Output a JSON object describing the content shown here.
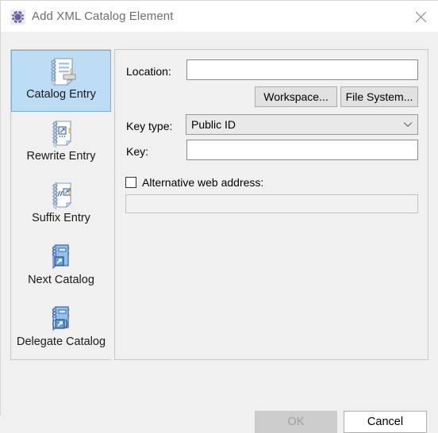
{
  "window": {
    "title": "Add XML Catalog Element",
    "icon": "xml-catalog-icon",
    "close_icon": "close-icon"
  },
  "sidebar": {
    "items": [
      {
        "label": "Catalog Entry",
        "icon": "catalog-entry-icon",
        "selected": true
      },
      {
        "label": "Rewrite Entry",
        "icon": "rewrite-entry-icon",
        "selected": false
      },
      {
        "label": "Suffix Entry",
        "icon": "suffix-entry-icon",
        "selected": false
      },
      {
        "label": "Next Catalog",
        "icon": "next-catalog-icon",
        "selected": false
      },
      {
        "label": "Delegate Catalog",
        "icon": "delegate-catalog-icon",
        "selected": false
      }
    ]
  },
  "form": {
    "location_label": "Location:",
    "location_value": "",
    "workspace_button": "Workspace...",
    "filesystem_button": "File System...",
    "keytype_label": "Key type:",
    "keytype_value": "Public ID",
    "keytype_chevron": "chevron-down-icon",
    "key_label": "Key:",
    "key_value": "",
    "alt_checkbox_label": "Alternative web address:",
    "alt_checkbox_checked": false,
    "alt_value": "",
    "alt_enabled": false
  },
  "footer": {
    "ok_label": "OK",
    "ok_enabled": false,
    "cancel_label": "Cancel",
    "cancel_enabled": true
  },
  "colors": {
    "selection_blue": "#bcdcf4",
    "selection_border": "#7aaedc",
    "dialog_background": "#f0f0f0",
    "titlebar_background": "#ffffff",
    "title_text": "#6e6e6e",
    "disabled_text": "#a0a0a0"
  }
}
